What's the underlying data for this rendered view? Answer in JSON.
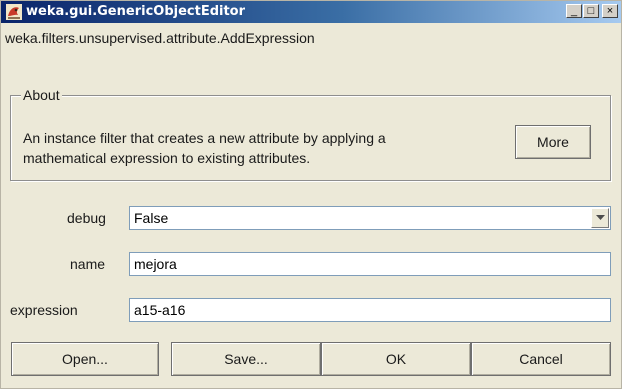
{
  "window": {
    "title": "weka.gui.GenericObjectEditor",
    "controls": {
      "minimize": "_",
      "maximize": "□",
      "close": "×"
    }
  },
  "filter_name": "weka.filters.unsupervised.attribute.AddExpression",
  "about": {
    "legend": "About",
    "line1": "An instance filter that creates a new attribute by applying a",
    "line2": "mathematical expression to existing attributes.",
    "more_label": "More"
  },
  "properties": {
    "debug": {
      "label": "debug",
      "value": "False"
    },
    "name": {
      "label": "name",
      "value": "mejora"
    },
    "expression": {
      "label": "expression",
      "value": "a15-a16"
    }
  },
  "buttons": {
    "open": "Open...",
    "save": "Save...",
    "ok": "OK",
    "cancel": "Cancel"
  },
  "colors": {
    "title_start": "#0a246a",
    "title_end": "#a6caf0",
    "dialog_bg": "#ece9d8",
    "field_border": "#7f9db9"
  },
  "icons": {
    "app": "weka-bird-icon",
    "combo": "triangle-down-icon"
  }
}
